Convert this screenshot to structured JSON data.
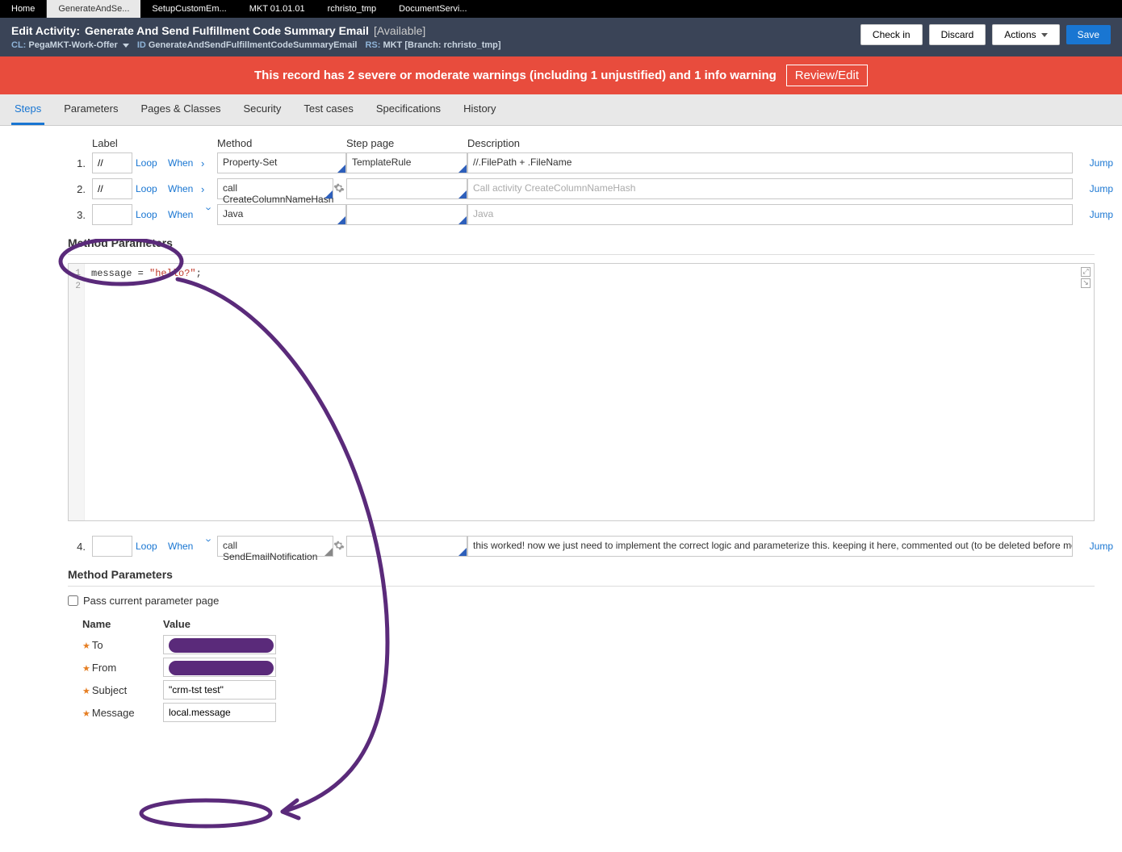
{
  "tabs": [
    "Home",
    "GenerateAndSe...",
    "SetupCustomEm...",
    "MKT 01.01.01",
    "rchristo_tmp",
    "DocumentServi..."
  ],
  "header": {
    "prefix": "Edit Activity:",
    "name": "Generate And Send Fulfillment Code Summary Email",
    "avail": "[Available]",
    "cl_lbl": "CL:",
    "cl": "PegaMKT-Work-Offer",
    "id_lbl": "ID",
    "id": "GenerateAndSendFulfillmentCodeSummaryEmail",
    "rs_lbl": "RS:",
    "rs": "MKT [Branch: rchristo_tmp]",
    "checkin": "Check in",
    "discard": "Discard",
    "actions": "Actions",
    "save": "Save"
  },
  "warn": {
    "msg": "This record has 2 severe or moderate warnings (including 1 unjustified) and 1 info warning",
    "review": "Review/Edit"
  },
  "subtabs": [
    "Steps",
    "Parameters",
    "Pages & Classes",
    "Security",
    "Test cases",
    "Specifications",
    "History"
  ],
  "cols": {
    "label": "Label",
    "method": "Method",
    "step_page": "Step page",
    "description": "Description"
  },
  "loop": "Loop",
  "when": "When",
  "jump": "Jump",
  "steps": [
    {
      "n": "1.",
      "label": "//",
      "method": "Property-Set",
      "page": "TemplateRule",
      "desc": "//.FilePath + .FileName",
      "expanded": true
    },
    {
      "n": "2.",
      "label": "//",
      "method": "call CreateColumnNameHash",
      "page": "",
      "desc": "Call activity CreateColumnNameHash",
      "expanded": true
    },
    {
      "n": "3.",
      "label": "",
      "method": "Java",
      "page": "",
      "desc": "Java",
      "expanded": false
    },
    {
      "n": "4.",
      "label": "",
      "method": "call SendEmailNotification",
      "page": "",
      "desc": "this worked! now we just need to implement the correct logic and parameterize this.  keeping it here, commented out (to be deleted before merging) f",
      "expanded": false
    }
  ],
  "mp_title": "Method Parameters",
  "code": {
    "line1a": "message = ",
    "line1b": "\"hello?\"",
    "line1c": ";"
  },
  "pass": "Pass current parameter page",
  "param_cols": {
    "name": "Name",
    "value": "Value"
  },
  "params": [
    {
      "name": "To",
      "redacted": true
    },
    {
      "name": "From",
      "redacted": true
    },
    {
      "name": "Subject",
      "value": "\"crm-tst test\""
    },
    {
      "name": "Message",
      "value": "local.message"
    }
  ]
}
